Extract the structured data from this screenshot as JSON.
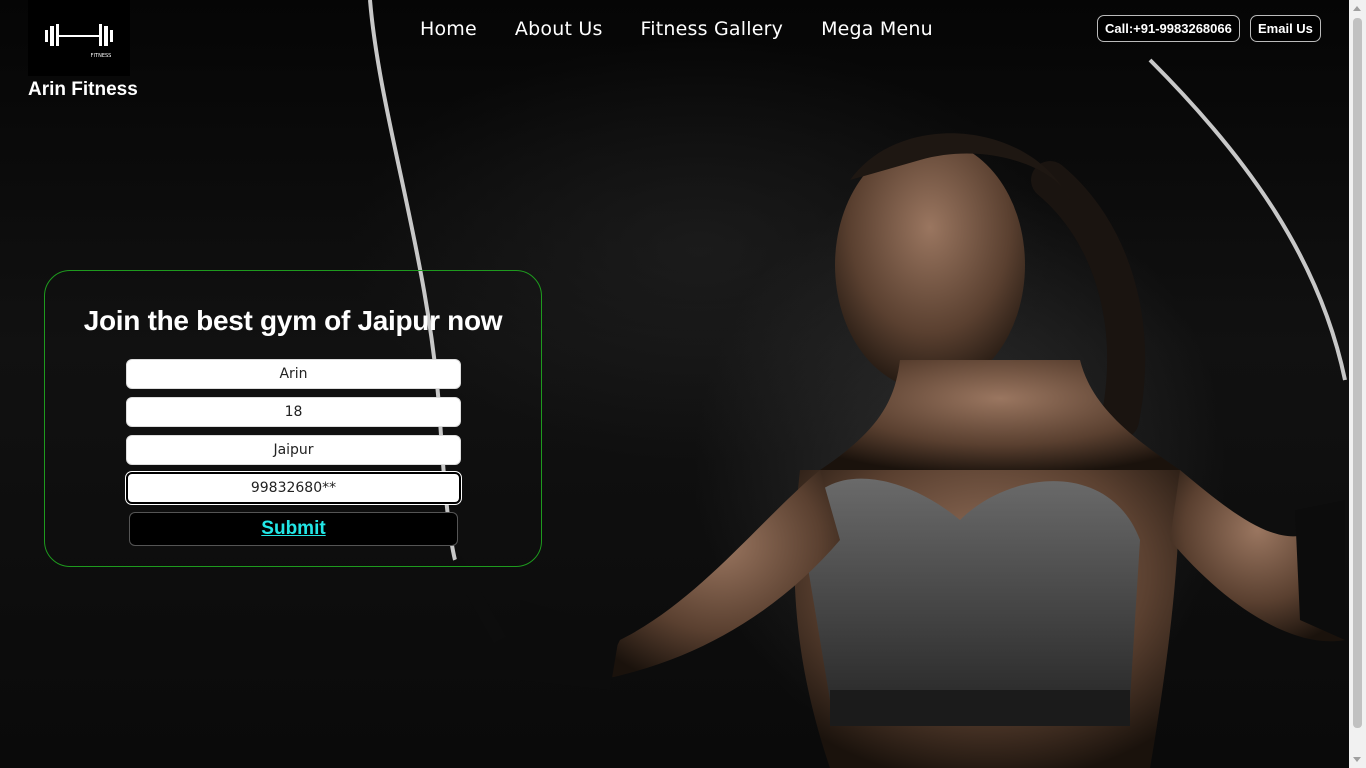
{
  "brand": {
    "name": "Arin Fitness",
    "logo_text": "FITNESS",
    "icon": "barbell-logo-icon"
  },
  "nav": {
    "items": [
      "Home",
      "About Us",
      "Fitness Gallery",
      "Mega Menu"
    ]
  },
  "contact": {
    "call_label": "Call:+91-9983268066",
    "email_label": "Email Us"
  },
  "form": {
    "title": "Join the best gym of Jaipur now",
    "fields": {
      "name": "Arin",
      "age": "18",
      "city": "Jaipur",
      "phone": "99832680**"
    },
    "submit_label": "Submit"
  },
  "colors": {
    "accent_link": "#22e6e6",
    "card_border": "#1e9a1e",
    "background": "#000000"
  }
}
